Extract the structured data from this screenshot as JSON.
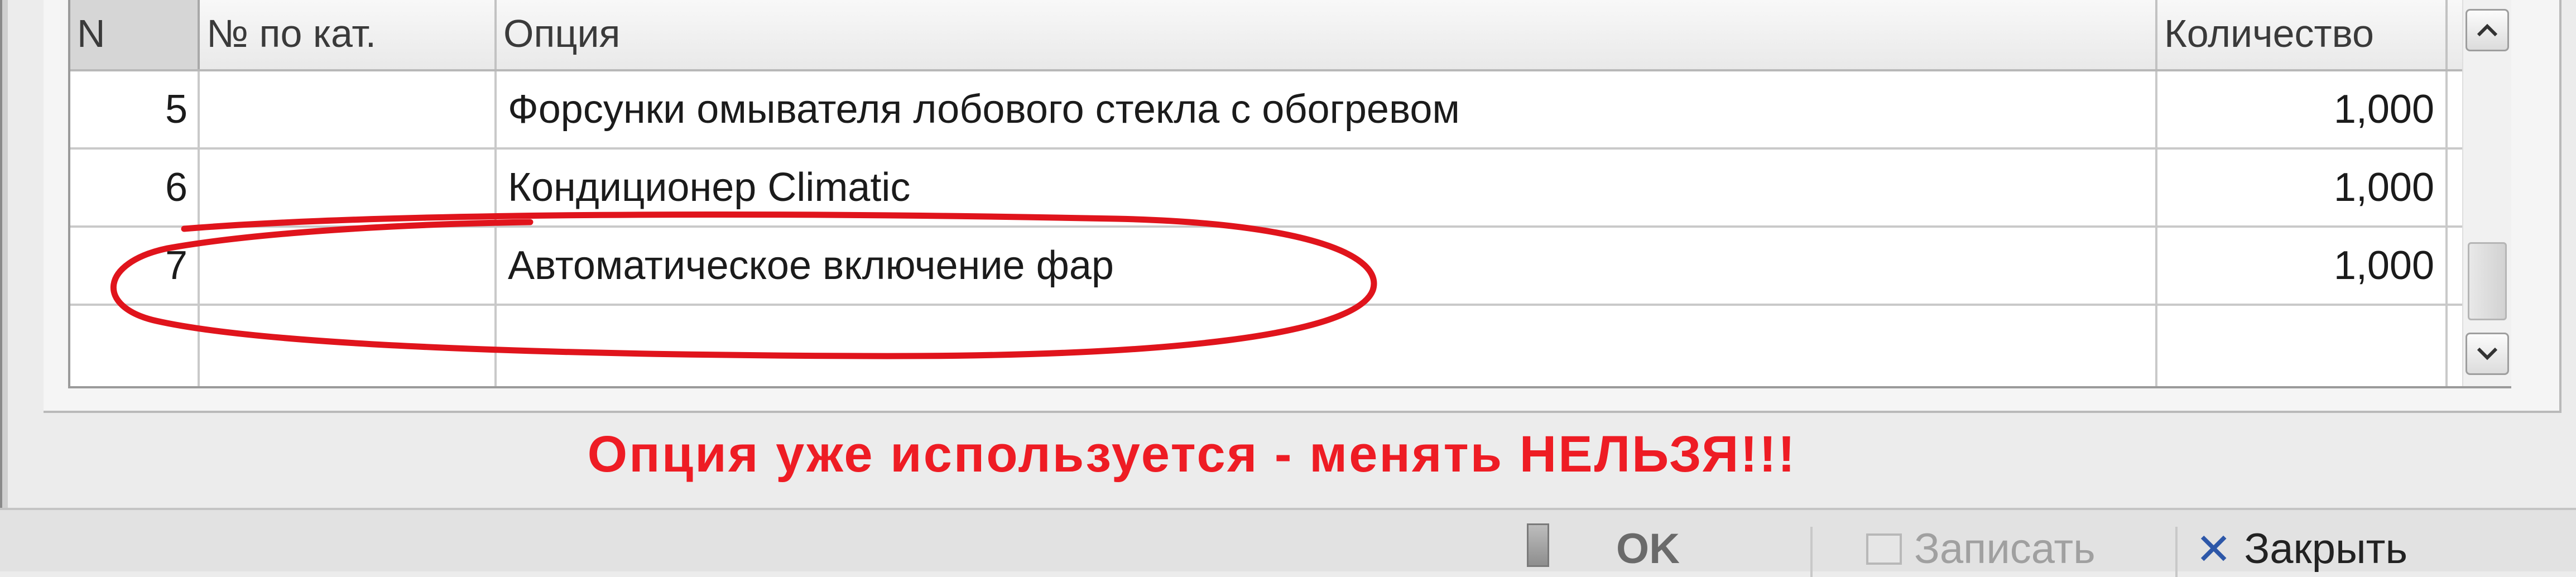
{
  "grid": {
    "columns": {
      "n": "N",
      "catalog_no": "№ по кат.",
      "option": "Опция",
      "quantity": "Количество"
    },
    "rows": [
      {
        "n": "5",
        "catalog_no": "",
        "option": "Форсунки омывателя лобового стекла с обогревом",
        "quantity": "1,000"
      },
      {
        "n": "6",
        "catalog_no": "",
        "option": "Кондиционер Climatic",
        "quantity": "1,000"
      },
      {
        "n": "7",
        "catalog_no": "",
        "option": "Автоматическое включение фар",
        "quantity": "1,000"
      }
    ],
    "scrollbar": {
      "up_icon": "chevron-up-icon",
      "down_icon": "chevron-down-icon"
    }
  },
  "warning_text": "Опция уже используется - менять НЕЛЬЗЯ!!!",
  "colors": {
    "warning": "#ee1c24",
    "annotation": "#e0141c",
    "close_icon": "#2d57a8"
  },
  "buttons": {
    "ok": "OK",
    "save": "Записать",
    "close": "Закрыть",
    "close_icon": "close-x-icon",
    "save_icon": "save-icon"
  }
}
